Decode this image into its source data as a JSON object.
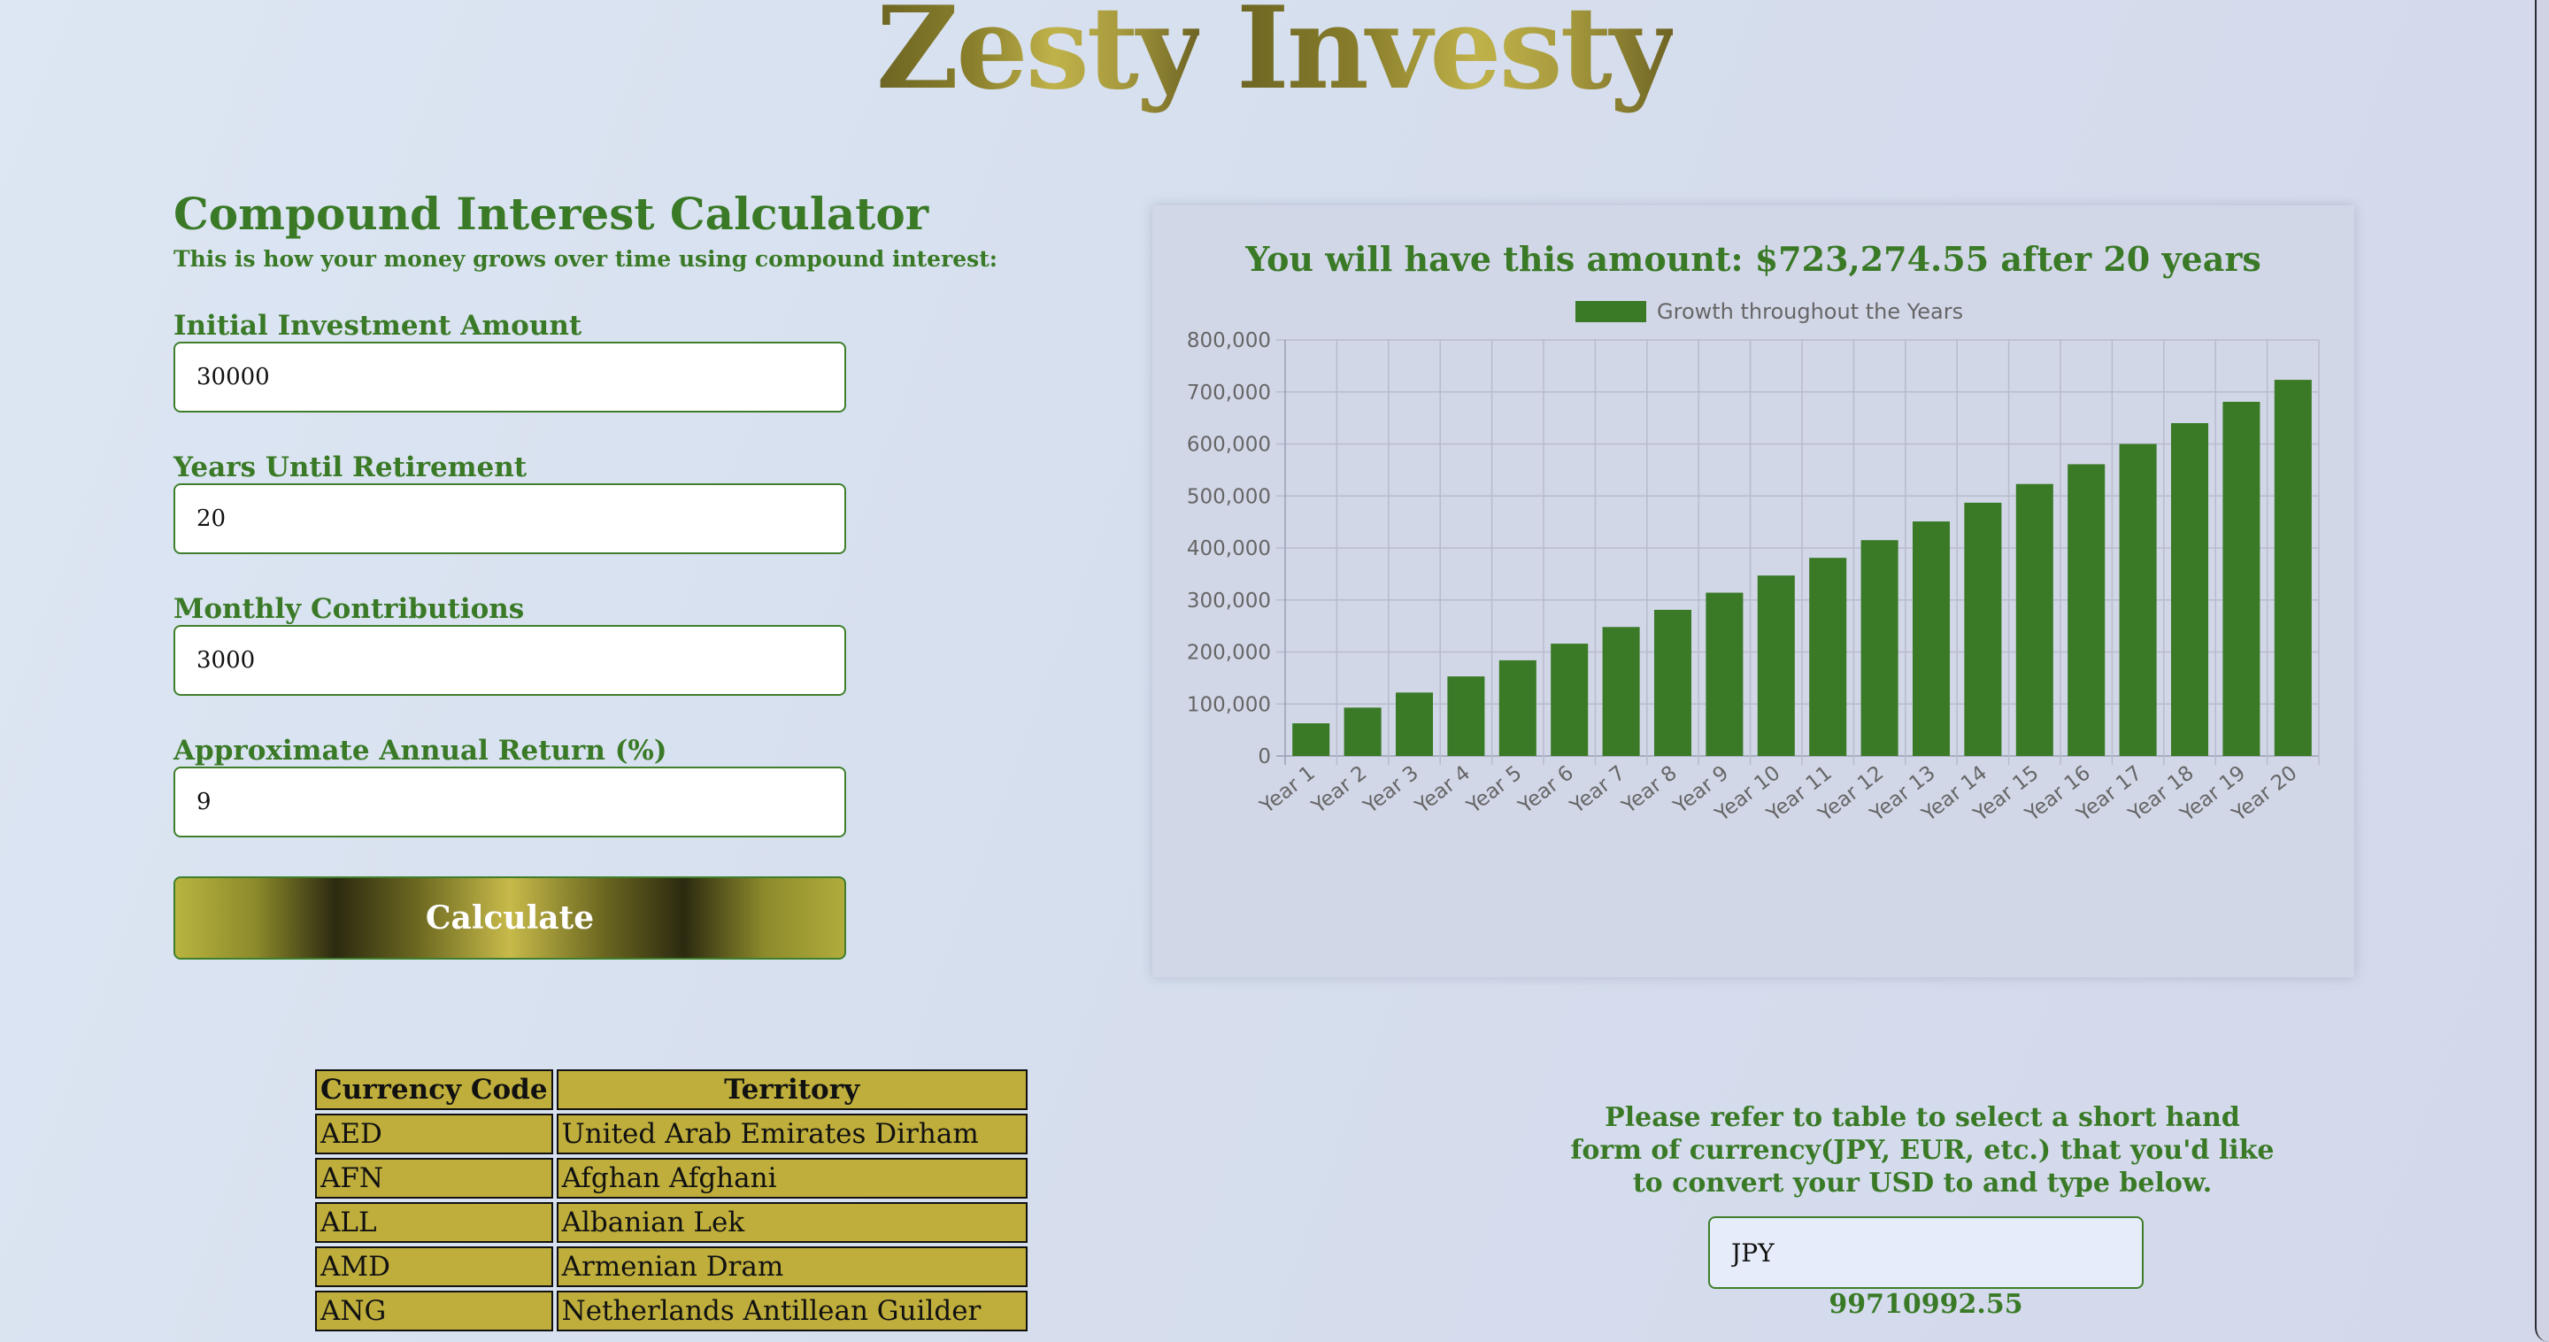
{
  "brand": {
    "part1": "Zesty",
    "part2": "Investy"
  },
  "calculator": {
    "title": "Compound Interest Calculator",
    "subtitle": "This is how your money grows over time using compound interest:",
    "fields": [
      {
        "label": "Initial Investment Amount",
        "value": "30000"
      },
      {
        "label": "Years Until Retirement",
        "value": "20"
      },
      {
        "label": "Monthly Contributions",
        "value": "3000"
      },
      {
        "label": "Approximate Annual Return (%)",
        "value": "9"
      }
    ],
    "button_label": "Calculate"
  },
  "chart_data": {
    "type": "bar",
    "title": "You will have this amount: $723,274.55 after 20 years",
    "legend": [
      "Growth throughout the Years"
    ],
    "legend_position": "top",
    "grid": true,
    "color": "#3a7a27",
    "categories": [
      "Year 1",
      "Year 2",
      "Year 3",
      "Year 4",
      "Year 5",
      "Year 6",
      "Year 7",
      "Year 8",
      "Year 9",
      "Year 10",
      "Year 11",
      "Year 12",
      "Year 13",
      "Year 14",
      "Year 15",
      "Year 16",
      "Year 17",
      "Year 18",
      "Year 19",
      "Year 20"
    ],
    "series": [
      {
        "name": "Growth throughout the Years",
        "values": [
          62800,
          93000,
          122000,
          153000,
          184000,
          216000,
          248000,
          281000,
          314000,
          347000,
          381000,
          415000,
          451000,
          487000,
          523000,
          561000,
          600000,
          640000,
          681000,
          723274.55
        ]
      }
    ],
    "ylim": [
      0,
      800000
    ],
    "yticks": [
      "0",
      "100,000",
      "200,000",
      "300,000",
      "400,000",
      "500,000",
      "600,000",
      "700,000",
      "800,000"
    ],
    "xlabel": "",
    "ylabel": ""
  },
  "currency_table": {
    "headers": [
      "Currency Code",
      "Territory"
    ],
    "rows": [
      [
        "AED",
        "United Arab Emirates Dirham"
      ],
      [
        "AFN",
        "Afghan Afghani"
      ],
      [
        "ALL",
        "Albanian Lek"
      ],
      [
        "AMD",
        "Armenian Dram"
      ],
      [
        "ANG",
        "Netherlands Antillean Guilder"
      ]
    ]
  },
  "converter": {
    "instructions": "Please refer to table to select a short hand form of currency(JPY, EUR, etc.) that you'd like to convert your USD to and type below.",
    "input_value": "JPY",
    "result": "99710992.55"
  },
  "colors": {
    "accent_green": "#3a7a27",
    "table_gold": "#bfae3c"
  }
}
